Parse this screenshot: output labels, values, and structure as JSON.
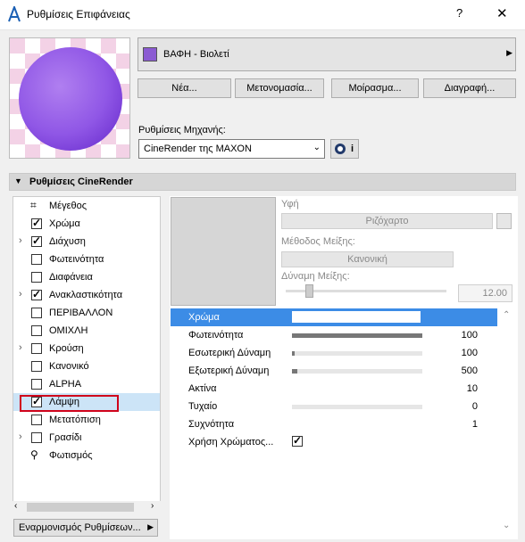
{
  "window": {
    "title": "Ρυθμίσεις Επιφάνειας",
    "help": "?",
    "close": "✕"
  },
  "material": {
    "name": "ΒΑΦΗ - Βιολετί",
    "swatch_color": "#8b5bd2"
  },
  "buttons": {
    "new": "Νέα...",
    "rename": "Μετονομασία...",
    "share": "Μοίρασμα...",
    "delete": "Διαγραφή..."
  },
  "engine": {
    "label": "Ρυθμίσεις Μηχανής:",
    "value": "CineRender της MAXON",
    "info": "i"
  },
  "section": {
    "title": "Ρυθμίσεις CineRender"
  },
  "channels": [
    {
      "label": "Μέγεθος",
      "checked": false,
      "expandable": false,
      "icon": "size-icon"
    },
    {
      "label": "Χρώμα",
      "checked": true,
      "expandable": false
    },
    {
      "label": "Διάχυση",
      "checked": true,
      "expandable": true
    },
    {
      "label": "Φωτεινότητα",
      "checked": false,
      "expandable": false
    },
    {
      "label": "Διαφάνεια",
      "checked": false,
      "expandable": false
    },
    {
      "label": "Ανακλαστικότητα",
      "checked": true,
      "expandable": true
    },
    {
      "label": "ΠΕΡΙΒΑΛΛΟΝ",
      "checked": false,
      "expandable": false
    },
    {
      "label": "ΟΜΙΧΛΗ",
      "checked": false,
      "expandable": false
    },
    {
      "label": "Κρούση",
      "checked": false,
      "expandable": true
    },
    {
      "label": "Κανονικό",
      "checked": false,
      "expandable": false
    },
    {
      "label": "ALPHA",
      "checked": false,
      "expandable": false
    },
    {
      "label": "Λάμψη",
      "checked": true,
      "expandable": false,
      "selected": true
    },
    {
      "label": "Μετατόπιση",
      "checked": false,
      "expandable": false
    },
    {
      "label": "Γρασίδι",
      "checked": false,
      "expandable": true
    },
    {
      "label": "Φωτισμός",
      "checked": false,
      "expandable": false,
      "icon": "lighting-icon"
    }
  ],
  "update_button": "Εναρμονισμός Ρυθμίσεων...",
  "texture": {
    "label": "Υφή",
    "value": "Ριζόχαρτο",
    "blend_method_label": "Μέθοδος Μείξης:",
    "blend_method_value": "Κανονική",
    "blend_strength_label": "Δύναμη Μείξης:",
    "blend_strength_value": "12.00"
  },
  "properties": [
    {
      "label": "Χρώμα",
      "type": "color",
      "value": "",
      "selected": true
    },
    {
      "label": "Φωτεινότητα",
      "type": "slider",
      "fraction": 1.0,
      "value": "100"
    },
    {
      "label": "Εσωτερική Δύναμη",
      "type": "slider",
      "fraction": 0.02,
      "value": "100"
    },
    {
      "label": "Εξωτερική Δύναμη",
      "type": "slider",
      "fraction": 0.04,
      "value": "500"
    },
    {
      "label": "Ακτίνα",
      "type": "number",
      "value": "10"
    },
    {
      "label": "Τυχαίο",
      "type": "slider",
      "fraction": 0.0,
      "value": "0"
    },
    {
      "label": "Συχνότητα",
      "type": "number",
      "value": "1"
    },
    {
      "label": "Χρήση Χρώματος...",
      "type": "checkbox",
      "checked": true,
      "value": ""
    }
  ]
}
